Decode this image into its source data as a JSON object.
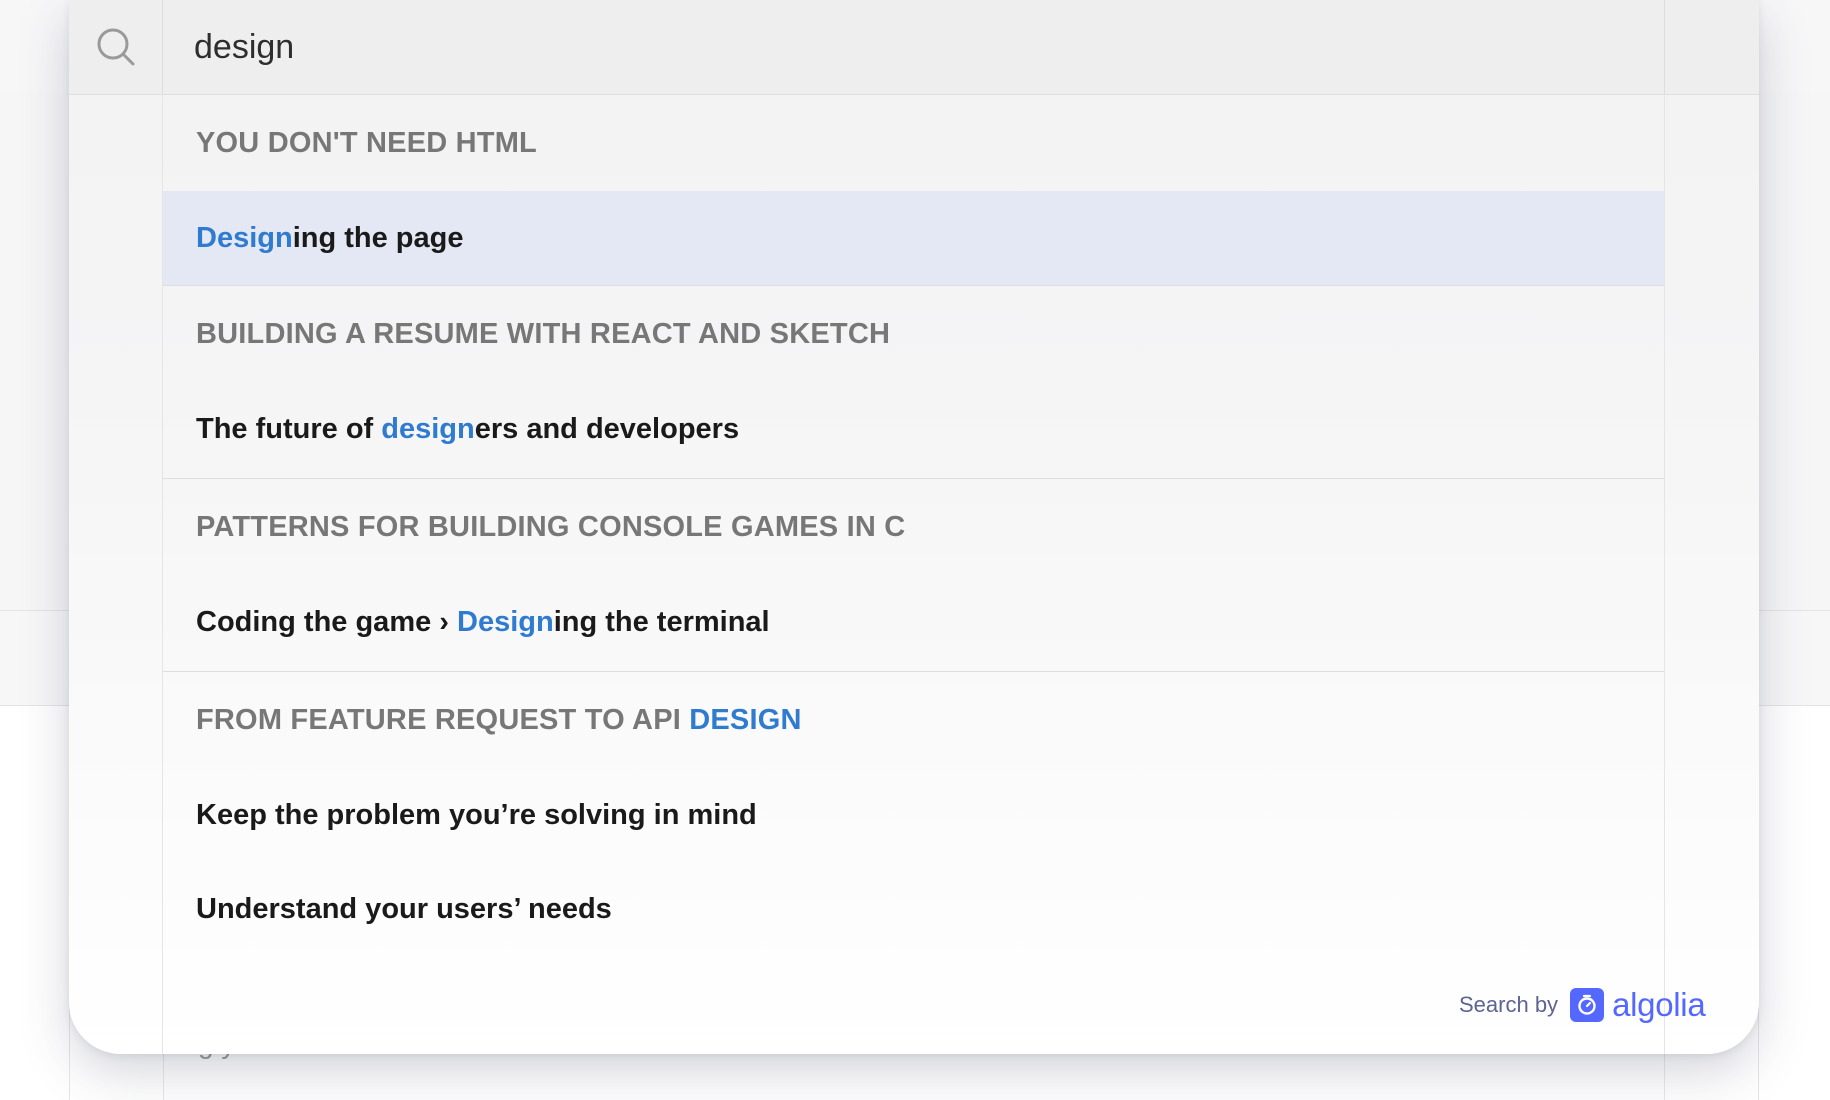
{
  "search": {
    "query": "design"
  },
  "results": {
    "group1": {
      "title": "YOU DON'T NEED HTML",
      "item1": {
        "hl": "Design",
        "rest": "ing the page"
      }
    },
    "group2": {
      "title": "BUILDING A RESUME WITH REACT AND SKETCH",
      "item1": {
        "pre": "The future of ",
        "hl": "design",
        "rest": "ers and developers"
      }
    },
    "group3": {
      "title": "PATTERNS FOR BUILDING CONSOLE GAMES IN C",
      "item1": {
        "pre": "Coding the game › ",
        "hl": "Design",
        "rest": "ing the terminal"
      }
    },
    "group4": {
      "title_pre": "FROM FEATURE REQUEST TO API ",
      "title_hl": "DESIGN",
      "item1": "Keep the problem you’re solving in mind",
      "item2": "Understand your users’ needs"
    }
  },
  "footer": {
    "search_by": "Search by",
    "brand": "algolia"
  },
  "background": {
    "fragment": "g    y"
  },
  "colors": {
    "highlight": "#2f7bd0",
    "selected_bg": "#e4e7f4",
    "algolia": "#5468ff"
  }
}
